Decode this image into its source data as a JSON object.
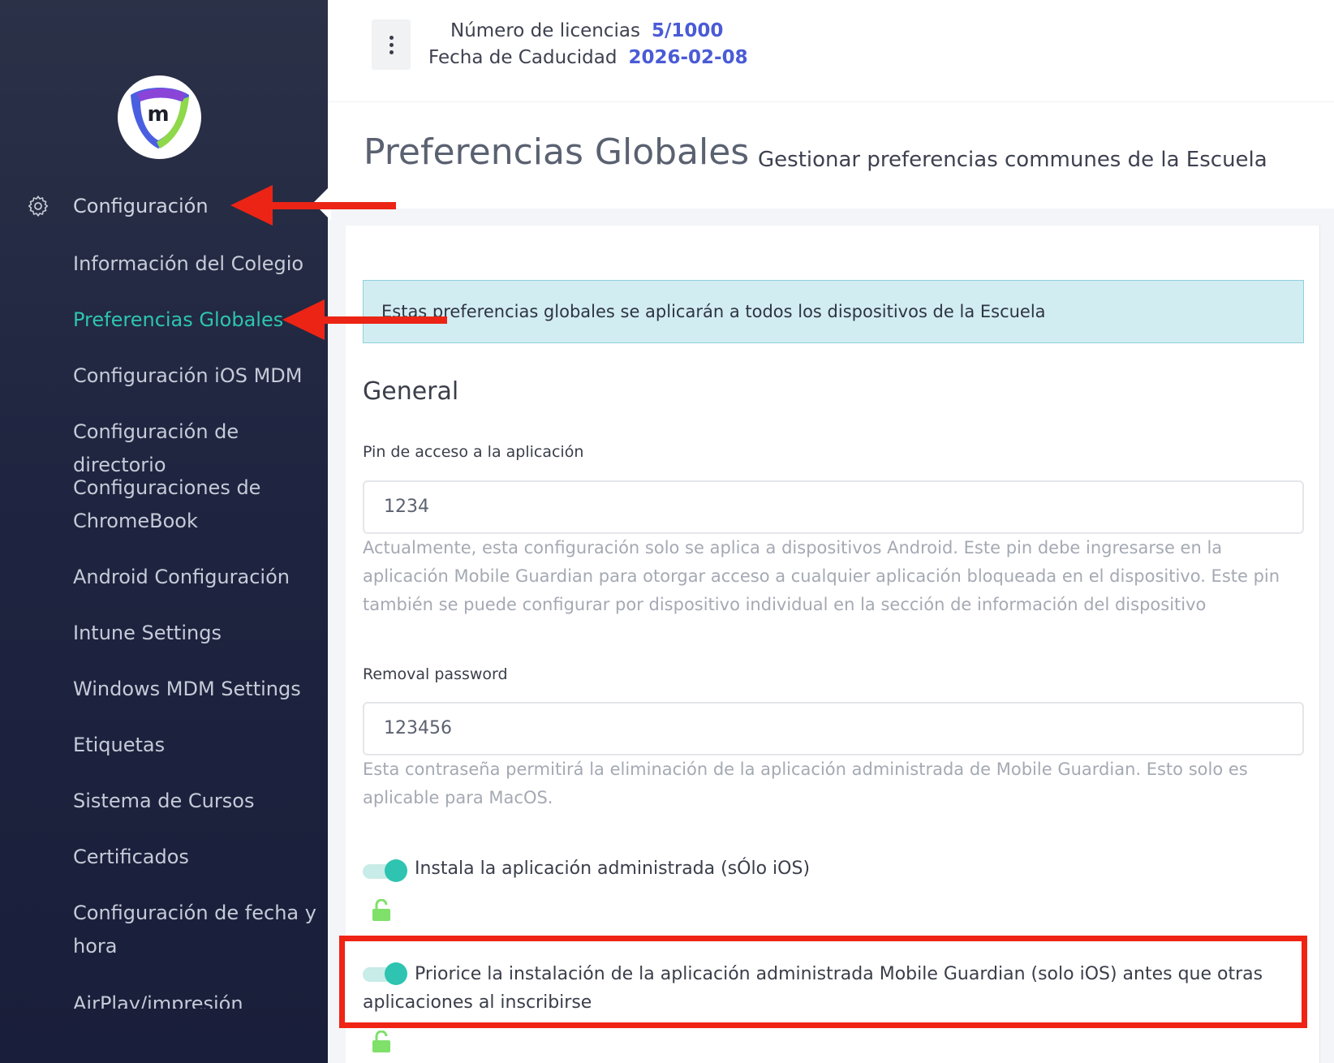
{
  "colors": {
    "sidebar_bg": "#1f2540",
    "accent_teal": "#2ec4b1",
    "license_value": "#4a5bd6",
    "info_bg": "#d2edf2",
    "annotation_red": "#ec2415"
  },
  "sidebar": {
    "logo_letter": "m",
    "section_icon": "gear-icon",
    "section_label": "Configuración",
    "items": [
      {
        "label": "Información del Colegio"
      },
      {
        "label": "Preferencias Globales",
        "active": true
      },
      {
        "label": "Configuración iOS MDM"
      },
      {
        "label": "Configuración de directorio"
      },
      {
        "label": "Configuraciones de ChromeBook"
      },
      {
        "label": "Android Configuración"
      },
      {
        "label": "Intune Settings"
      },
      {
        "label": "Windows MDM Settings"
      },
      {
        "label": "Etiquetas"
      },
      {
        "label": "Sistema de Cursos"
      },
      {
        "label": "Certificados"
      },
      {
        "label": "Configuración de fecha y hora"
      },
      {
        "label": "AirPlay/impresión"
      }
    ]
  },
  "topbar": {
    "menu_icon": "kebab-menu-icon",
    "licenses_label": "Número de licencias",
    "licenses_value": "5/1000",
    "expiry_label": "Fecha de Caducidad",
    "expiry_value": "2026-02-08"
  },
  "header": {
    "title": "Preferencias Globales",
    "subtitle": "Gestionar preferencias communes de la Escuela"
  },
  "main": {
    "info_text": "Estas preferencias globales se aplicarán a todos los dispositivos de la Escuela",
    "section_title": "General",
    "pin": {
      "label": "Pin de acceso a la aplicación",
      "value": "1234",
      "help": "Actualmente, esta configuración solo se aplica a dispositivos Android. Este pin debe ingresarse en la aplicación Mobile Guardian para otorgar acceso a cualquier aplicación bloqueada en el dispositivo. Este pin también se puede configurar por dispositivo individual en la sección de información del dispositivo"
    },
    "removal": {
      "label": "Removal password",
      "value": "123456",
      "help": "Esta contraseña permitirá la eliminación de la aplicación administrada de Mobile Guardian. Esto solo es aplicable para MacOS."
    },
    "toggles": [
      {
        "label": "Instala la aplicación administrada (sÓlo iOS)",
        "on": true,
        "lock_icon": "unlocked-padlock-icon"
      },
      {
        "label": "Priorice la instalación de la aplicación administrada Mobile Guardian (solo iOS) antes que otras aplicaciones al inscribirse",
        "on": true,
        "lock_icon": "unlocked-padlock-icon"
      }
    ]
  }
}
